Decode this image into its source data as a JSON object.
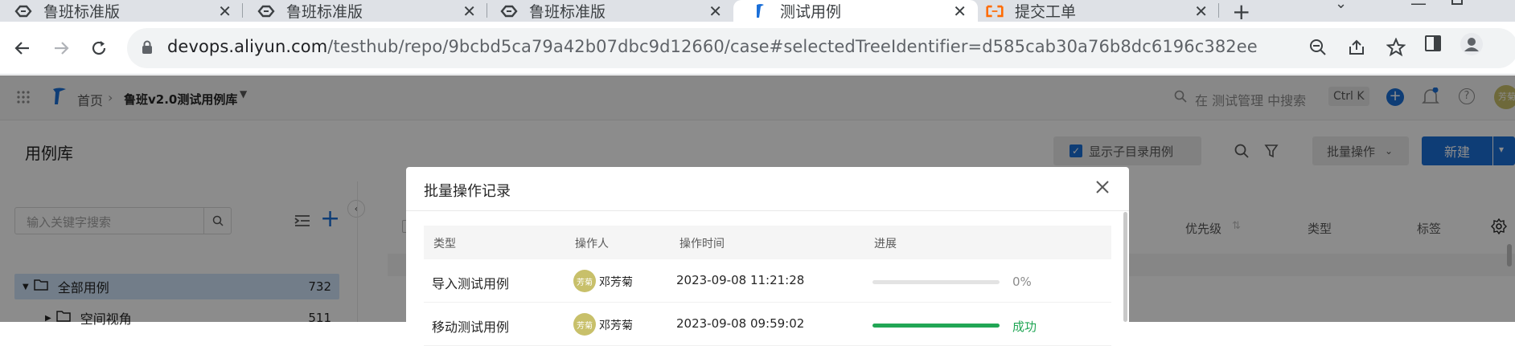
{
  "browser": {
    "tabs": [
      {
        "title": "鲁班标准版",
        "icon": "aliyun-devops-icon",
        "active": false
      },
      {
        "title": "鲁班标准版",
        "icon": "aliyun-devops-icon",
        "active": false
      },
      {
        "title": "鲁班标准版",
        "icon": "aliyun-devops-icon",
        "active": false
      },
      {
        "title": "测试用例",
        "icon": "testhub-icon",
        "active": true
      },
      {
        "title": "提交工单",
        "icon": "aliyun-ticket-icon",
        "active": false
      }
    ],
    "url_host": "devops.aliyun.com",
    "url_path": "/testhub/repo/9bcbd5ca79a42b07dbc9d12660/case#selectedTreeIdentifier=d585cab30a76b8dc6196c382ee"
  },
  "app": {
    "breadcrumb_home": "首页",
    "breadcrumb_project": "鲁班v2.0测试用例库",
    "search_placeholder": "在 测试管理 中搜索",
    "search_shortcut": "Ctrl K",
    "avatar_text": "芳菊"
  },
  "page": {
    "title": "用例库",
    "show_sub_checkbox_label": "显示子目录用例",
    "show_sub_checked": true,
    "batch_button": "批量操作",
    "new_button": "新建",
    "tree_search_placeholder": "输入关键字搜索",
    "tree": [
      {
        "label": "全部用例",
        "count": "732",
        "selected": true
      },
      {
        "label": "空间视角",
        "count": "511",
        "selected": false
      }
    ],
    "columns": {
      "priority": "优先级",
      "type": "类型",
      "tags": "标签"
    }
  },
  "modal": {
    "title": "批量操作记录",
    "headers": {
      "type": "类型",
      "operator": "操作人",
      "time": "操作时间",
      "progress": "进展"
    },
    "rows": [
      {
        "type": "导入测试用例",
        "avatar": "芳菊",
        "operator": "邓芳菊",
        "time": "2023-09-08 11:21:28",
        "progress": 0,
        "progress_text": "0%",
        "status_color": "#8c8c8c"
      },
      {
        "type": "移动测试用例",
        "avatar": "芳菊",
        "operator": "邓芳菊",
        "time": "2023-09-08 09:59:02",
        "progress": 100,
        "progress_text": "成功",
        "status_color": "#21a655"
      }
    ]
  },
  "colors": {
    "primary": "#1b6fd8",
    "success": "#21a655",
    "mask": "rgba(0,0,0,0.45)"
  }
}
